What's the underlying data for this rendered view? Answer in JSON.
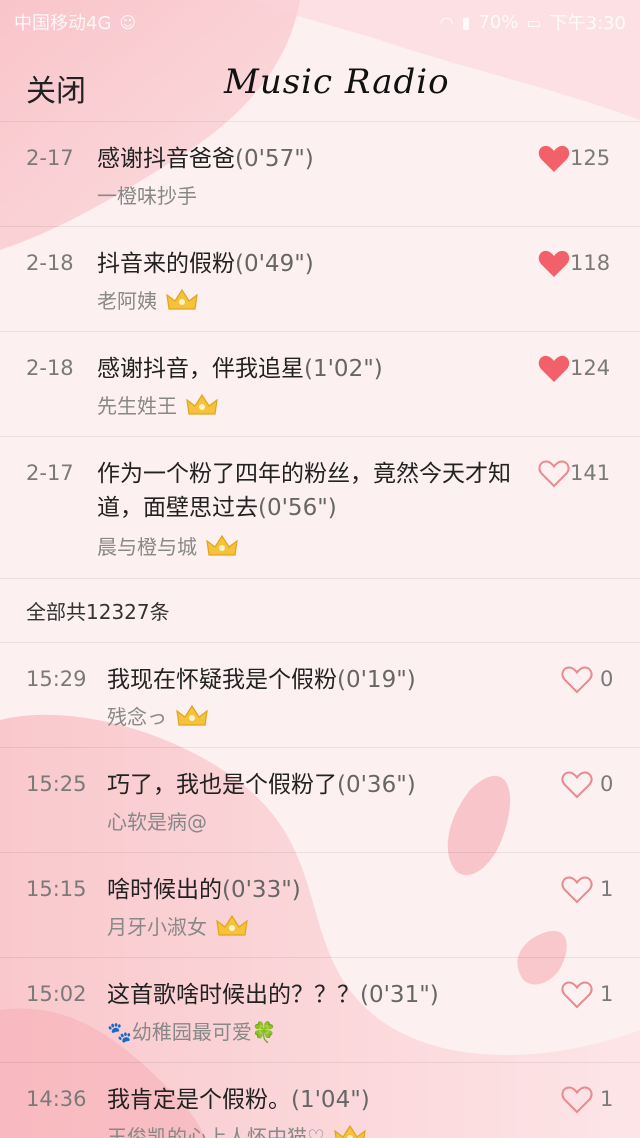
{
  "status_bar": {
    "carrier": "中国移动4G",
    "battery": "70%",
    "time": "下午3:30"
  },
  "header": {
    "close_label": "关闭",
    "title": "Music Radio"
  },
  "top_comments": [
    {
      "date": "2-17",
      "text": "感谢抖音爸爸",
      "duration": "(0'57\")",
      "user": "一橙味抄手",
      "has_badge": false,
      "liked": true,
      "count": "125"
    },
    {
      "date": "2-18",
      "text": "抖音来的假粉",
      "duration": "(0'49\")",
      "user": "老阿姨",
      "has_badge": true,
      "liked": true,
      "count": "118"
    },
    {
      "date": "2-18",
      "text": "感谢抖音，伴我追星",
      "duration": "(1'02\")",
      "user": "先生姓王",
      "has_badge": true,
      "liked": true,
      "count": "124"
    },
    {
      "date": "2-17",
      "text": "作为一个粉了四年的粉丝，竟然今天才知道，面壁思过去",
      "duration": "(0'56\")",
      "user": "晨与橙与城",
      "has_badge": true,
      "liked": false,
      "count": "141"
    }
  ],
  "section": {
    "total_label": "全部共12327条"
  },
  "recent_comments": [
    {
      "date": "15:29",
      "text": "我现在怀疑我是个假粉",
      "duration": "(0'19\")",
      "user": "残念っ",
      "has_badge": true,
      "liked": false,
      "count": "0"
    },
    {
      "date": "15:25",
      "text": "巧了，我也是个假粉了",
      "duration": "(0'36\")",
      "user": "心软是病@",
      "has_badge": false,
      "liked": false,
      "count": "0"
    },
    {
      "date": "15:15",
      "text": "啥时候出的",
      "duration": "(0'33\")",
      "user": "月牙小淑女",
      "has_badge": true,
      "liked": false,
      "count": "1"
    },
    {
      "date": "15:02",
      "text": "这首歌啥时候出的？？？",
      "duration": "(0'31\")",
      "user": "🐾幼稚园最可爱🍀",
      "has_badge": false,
      "liked": false,
      "count": "1"
    },
    {
      "date": "14:36",
      "text": "我肯定是个假粉。",
      "duration": "(1'04\")",
      "user": "王俊凯的心上人怀中猫♡",
      "has_badge": true,
      "liked": false,
      "count": "1"
    }
  ],
  "colors": {
    "heart": "#f2606a",
    "heart_outline": "#e88a90",
    "badge": "#f5c23a"
  }
}
